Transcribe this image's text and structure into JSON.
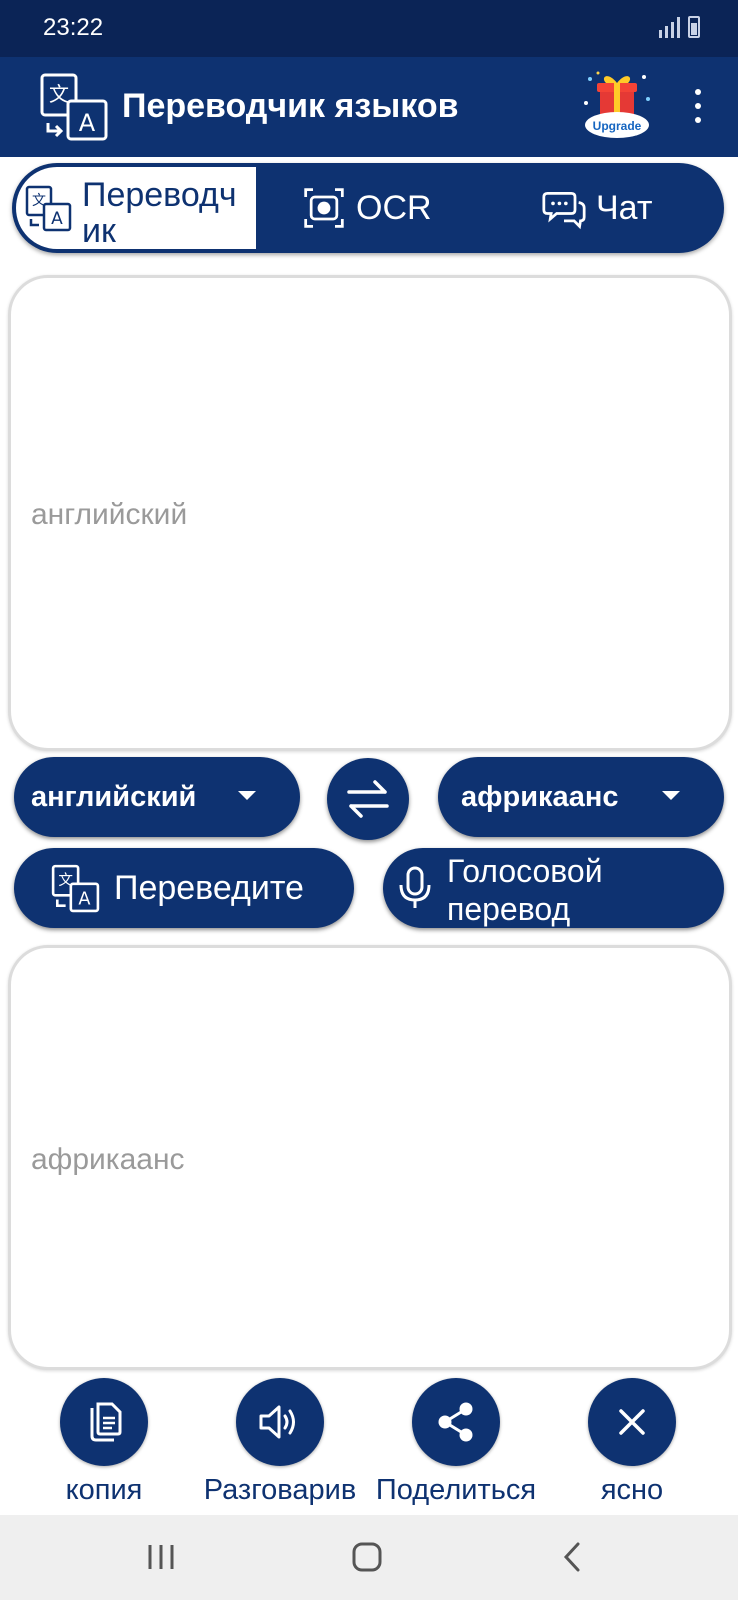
{
  "status_bar": {
    "time": "23:22"
  },
  "app_bar": {
    "title": "Переводчик языков",
    "upgrade_label": "Upgrade",
    "icons": [
      "translate-logo-icon",
      "upgrade-gift-icon",
      "more-vert-icon"
    ]
  },
  "tabs": [
    {
      "label": "Переводчик",
      "icon": "translate-icon",
      "active": true
    },
    {
      "label": "OCR",
      "icon": "camera-scan-icon",
      "active": false
    },
    {
      "label": "Чат",
      "icon": "chat-icon",
      "active": false
    }
  ],
  "source": {
    "placeholder": "английский"
  },
  "target": {
    "placeholder": "африкаанс"
  },
  "languages": {
    "source": "английский",
    "target": "африкаанс"
  },
  "buttons": {
    "translate": "Переведите",
    "voice": "Голосовой перевод"
  },
  "actions": [
    {
      "label": "копия",
      "icon": "copy-icon"
    },
    {
      "label": "Разговарив",
      "icon": "speaker-icon"
    },
    {
      "label": "Поделиться",
      "icon": "share-icon"
    },
    {
      "label": "ясно",
      "icon": "close-icon"
    }
  ],
  "colors": {
    "primary": "#0e3271",
    "status_bar": "#0b2456",
    "placeholder": "#9a9a9a",
    "nav_bar": "#efefef"
  }
}
